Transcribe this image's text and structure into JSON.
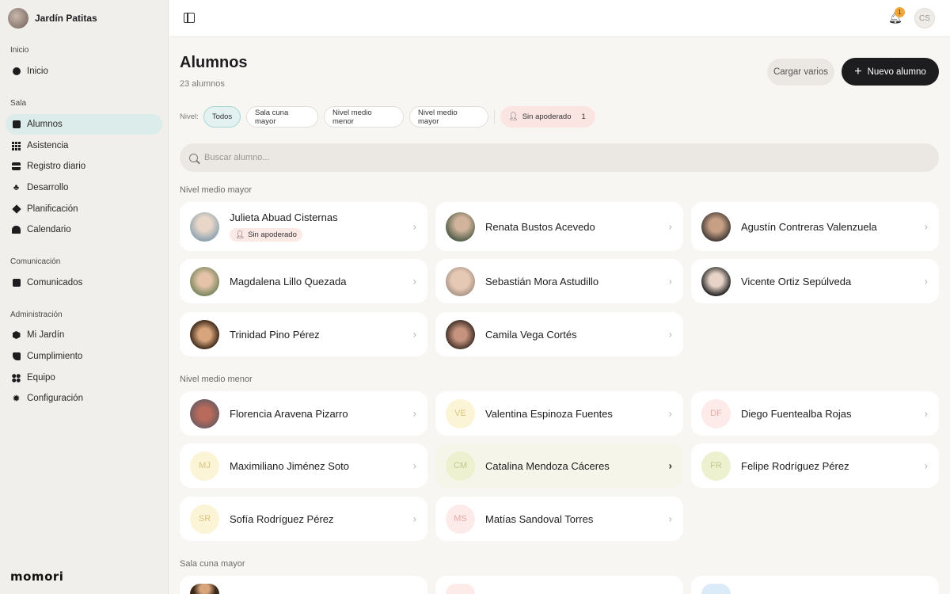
{
  "sidebar": {
    "brand": "Jardín Patitas",
    "sections": [
      {
        "label": "Inicio",
        "items": [
          {
            "label": "Inicio",
            "icon": "circle-icon"
          }
        ]
      },
      {
        "label": "Sala",
        "items": [
          {
            "label": "Alumnos",
            "icon": "square-icon",
            "active": true
          },
          {
            "label": "Asistencia",
            "icon": "grid-icon"
          },
          {
            "label": "Registro diario",
            "icon": "bars-icon"
          },
          {
            "label": "Desarrollo",
            "icon": "club-icon"
          },
          {
            "label": "Planificación",
            "icon": "diamond-icon"
          },
          {
            "label": "Calendario",
            "icon": "calendar-icon"
          }
        ]
      },
      {
        "label": "Comunicación",
        "items": [
          {
            "label": "Comunicados",
            "icon": "square-icon"
          }
        ]
      },
      {
        "label": "Administración",
        "items": [
          {
            "label": "Mi Jardín",
            "icon": "hexagon-icon"
          },
          {
            "label": "Cumplimiento",
            "icon": "flag-icon"
          },
          {
            "label": "Equipo",
            "icon": "people-icon"
          },
          {
            "label": "Configuración",
            "icon": "gear-icon"
          }
        ]
      }
    ],
    "logo": "momori"
  },
  "topbar": {
    "notification_count": "1",
    "user_initials": "CS"
  },
  "header": {
    "title": "Alumnos",
    "count": "23 alumnos",
    "btn_bulk": "Cargar varios",
    "btn_new": "Nuevo alumno"
  },
  "filters": {
    "label": "Nivel:",
    "chips": [
      "Todos",
      "Sala cuna mayor",
      "Nivel medio menor",
      "Nivel medio mayor"
    ],
    "active": "Todos",
    "warn_label": "Sin apoderado",
    "warn_count": "1"
  },
  "search": {
    "placeholder": "Buscar alumno..."
  },
  "groups": [
    {
      "label": "Nivel medio mayor",
      "students": [
        {
          "name": "Julieta Abuad Cisternas",
          "badge": "Sin apoderado",
          "photo": "ph-1"
        },
        {
          "name": "Renata Bustos Acevedo",
          "photo": "ph-2"
        },
        {
          "name": "Agustín Contreras Valenzuela",
          "photo": "ph-3"
        },
        {
          "name": "Magdalena Lillo Quezada",
          "photo": "ph-4"
        },
        {
          "name": "Sebastián Mora Astudillo",
          "photo": "ph-5"
        },
        {
          "name": "Vicente Ortiz Sepúlveda",
          "photo": "ph-6"
        },
        {
          "name": "Trinidad Pino Pérez",
          "photo": "ph-7"
        },
        {
          "name": "Camila Vega Cortés",
          "photo": "ph-8"
        }
      ]
    },
    {
      "label": "Nivel medio menor",
      "students": [
        {
          "name": "Florencia Aravena Pizarro",
          "photo": "ph-9"
        },
        {
          "name": "Valentina Espinoza Fuentes",
          "initials": "VE",
          "tone": "in-yellow"
        },
        {
          "name": "Diego Fuentealba Rojas",
          "initials": "DF",
          "tone": "in-pink"
        },
        {
          "name": "Maximiliano Jiménez Soto",
          "initials": "MJ",
          "tone": "in-yellow"
        },
        {
          "name": "Catalina Mendoza Cáceres",
          "initials": "CM",
          "tone": "in-green",
          "hover": true
        },
        {
          "name": "Felipe Rodríguez Pérez",
          "initials": "FR",
          "tone": "in-green"
        },
        {
          "name": "Sofía Rodríguez Pérez",
          "initials": "SR",
          "tone": "in-yellow"
        },
        {
          "name": "Matías Sandoval Torres",
          "initials": "MS",
          "tone": "in-pink"
        }
      ]
    },
    {
      "label": "Sala cuna mayor",
      "students": []
    }
  ],
  "colors": {
    "accent": "#1d1d1f",
    "active_nav": "#dceceb",
    "warn": "#fbe5e2",
    "badge": "#f0a63b"
  }
}
